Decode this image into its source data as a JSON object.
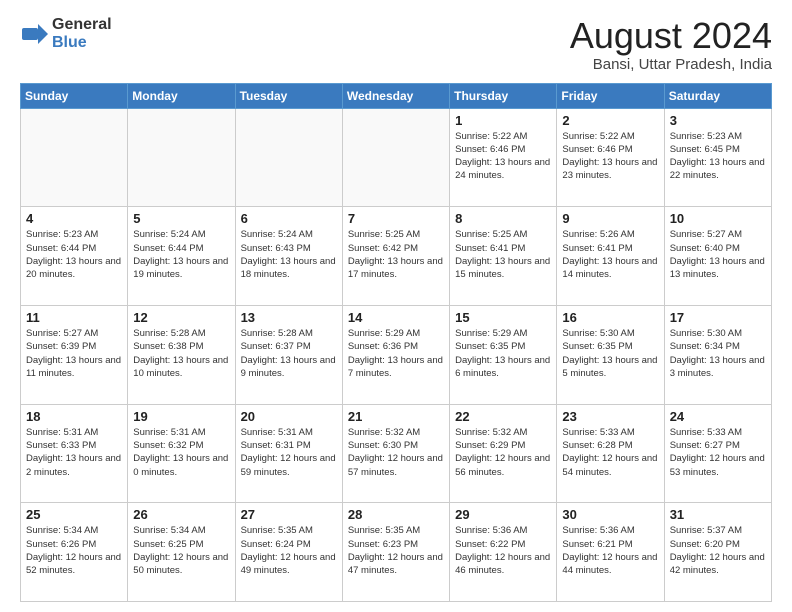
{
  "logo": {
    "general": "General",
    "blue": "Blue"
  },
  "title": "August 2024",
  "location": "Bansi, Uttar Pradesh, India",
  "days_of_week": [
    "Sunday",
    "Monday",
    "Tuesday",
    "Wednesday",
    "Thursday",
    "Friday",
    "Saturday"
  ],
  "weeks": [
    [
      {
        "day": "",
        "info": ""
      },
      {
        "day": "",
        "info": ""
      },
      {
        "day": "",
        "info": ""
      },
      {
        "day": "",
        "info": ""
      },
      {
        "day": "1",
        "info": "Sunrise: 5:22 AM\nSunset: 6:46 PM\nDaylight: 13 hours and 24 minutes."
      },
      {
        "day": "2",
        "info": "Sunrise: 5:22 AM\nSunset: 6:46 PM\nDaylight: 13 hours and 23 minutes."
      },
      {
        "day": "3",
        "info": "Sunrise: 5:23 AM\nSunset: 6:45 PM\nDaylight: 13 hours and 22 minutes."
      }
    ],
    [
      {
        "day": "4",
        "info": "Sunrise: 5:23 AM\nSunset: 6:44 PM\nDaylight: 13 hours and 20 minutes."
      },
      {
        "day": "5",
        "info": "Sunrise: 5:24 AM\nSunset: 6:44 PM\nDaylight: 13 hours and 19 minutes."
      },
      {
        "day": "6",
        "info": "Sunrise: 5:24 AM\nSunset: 6:43 PM\nDaylight: 13 hours and 18 minutes."
      },
      {
        "day": "7",
        "info": "Sunrise: 5:25 AM\nSunset: 6:42 PM\nDaylight: 13 hours and 17 minutes."
      },
      {
        "day": "8",
        "info": "Sunrise: 5:25 AM\nSunset: 6:41 PM\nDaylight: 13 hours and 15 minutes."
      },
      {
        "day": "9",
        "info": "Sunrise: 5:26 AM\nSunset: 6:41 PM\nDaylight: 13 hours and 14 minutes."
      },
      {
        "day": "10",
        "info": "Sunrise: 5:27 AM\nSunset: 6:40 PM\nDaylight: 13 hours and 13 minutes."
      }
    ],
    [
      {
        "day": "11",
        "info": "Sunrise: 5:27 AM\nSunset: 6:39 PM\nDaylight: 13 hours and 11 minutes."
      },
      {
        "day": "12",
        "info": "Sunrise: 5:28 AM\nSunset: 6:38 PM\nDaylight: 13 hours and 10 minutes."
      },
      {
        "day": "13",
        "info": "Sunrise: 5:28 AM\nSunset: 6:37 PM\nDaylight: 13 hours and 9 minutes."
      },
      {
        "day": "14",
        "info": "Sunrise: 5:29 AM\nSunset: 6:36 PM\nDaylight: 13 hours and 7 minutes."
      },
      {
        "day": "15",
        "info": "Sunrise: 5:29 AM\nSunset: 6:35 PM\nDaylight: 13 hours and 6 minutes."
      },
      {
        "day": "16",
        "info": "Sunrise: 5:30 AM\nSunset: 6:35 PM\nDaylight: 13 hours and 5 minutes."
      },
      {
        "day": "17",
        "info": "Sunrise: 5:30 AM\nSunset: 6:34 PM\nDaylight: 13 hours and 3 minutes."
      }
    ],
    [
      {
        "day": "18",
        "info": "Sunrise: 5:31 AM\nSunset: 6:33 PM\nDaylight: 13 hours and 2 minutes."
      },
      {
        "day": "19",
        "info": "Sunrise: 5:31 AM\nSunset: 6:32 PM\nDaylight: 13 hours and 0 minutes."
      },
      {
        "day": "20",
        "info": "Sunrise: 5:31 AM\nSunset: 6:31 PM\nDaylight: 12 hours and 59 minutes."
      },
      {
        "day": "21",
        "info": "Sunrise: 5:32 AM\nSunset: 6:30 PM\nDaylight: 12 hours and 57 minutes."
      },
      {
        "day": "22",
        "info": "Sunrise: 5:32 AM\nSunset: 6:29 PM\nDaylight: 12 hours and 56 minutes."
      },
      {
        "day": "23",
        "info": "Sunrise: 5:33 AM\nSunset: 6:28 PM\nDaylight: 12 hours and 54 minutes."
      },
      {
        "day": "24",
        "info": "Sunrise: 5:33 AM\nSunset: 6:27 PM\nDaylight: 12 hours and 53 minutes."
      }
    ],
    [
      {
        "day": "25",
        "info": "Sunrise: 5:34 AM\nSunset: 6:26 PM\nDaylight: 12 hours and 52 minutes."
      },
      {
        "day": "26",
        "info": "Sunrise: 5:34 AM\nSunset: 6:25 PM\nDaylight: 12 hours and 50 minutes."
      },
      {
        "day": "27",
        "info": "Sunrise: 5:35 AM\nSunset: 6:24 PM\nDaylight: 12 hours and 49 minutes."
      },
      {
        "day": "28",
        "info": "Sunrise: 5:35 AM\nSunset: 6:23 PM\nDaylight: 12 hours and 47 minutes."
      },
      {
        "day": "29",
        "info": "Sunrise: 5:36 AM\nSunset: 6:22 PM\nDaylight: 12 hours and 46 minutes."
      },
      {
        "day": "30",
        "info": "Sunrise: 5:36 AM\nSunset: 6:21 PM\nDaylight: 12 hours and 44 minutes."
      },
      {
        "day": "31",
        "info": "Sunrise: 5:37 AM\nSunset: 6:20 PM\nDaylight: 12 hours and 42 minutes."
      }
    ]
  ]
}
